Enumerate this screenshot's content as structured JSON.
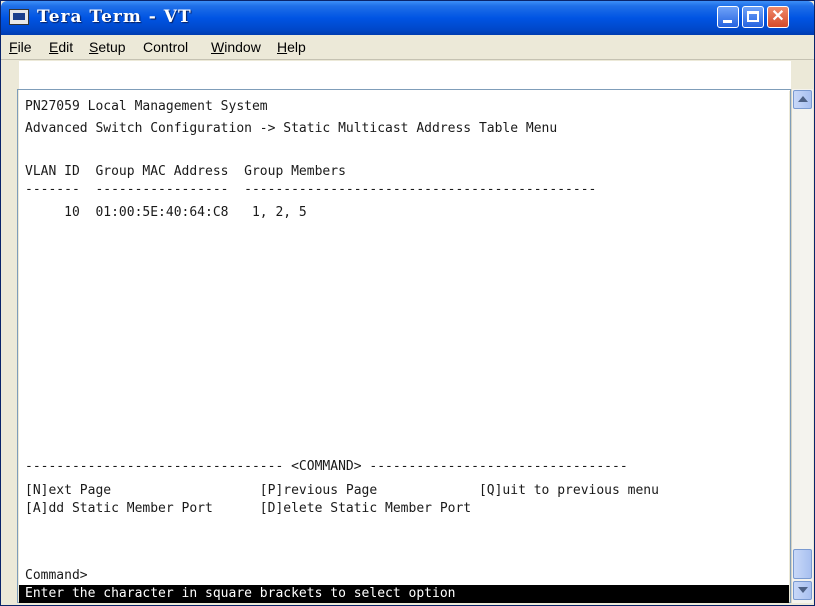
{
  "window": {
    "title": "Tera Term - VT"
  },
  "titlebar_buttons": {
    "close_glyph": "✕"
  },
  "menu": {
    "items": [
      {
        "first": "F",
        "rest": "ile"
      },
      {
        "first": "E",
        "rest": "dit"
      },
      {
        "first": "S",
        "rest": "etup"
      },
      {
        "first": "C",
        "rest": "ontrol",
        "prefix": ""
      },
      {
        "first": "W",
        "rest": "indow"
      },
      {
        "first": "H",
        "rest": "elp"
      }
    ]
  },
  "terminal": {
    "system_name": "PN27059 Local Management System",
    "breadcrumb": "Advanced Switch Configuration -> Static Multicast Address Table Menu",
    "table_header": "VLAN ID  Group MAC Address  Group Members",
    "table_rule": "-------  -----------------  ---------------------------------------------",
    "rows": [
      {
        "text": "     10  01:00:5E:40:64:C8   1, 2, 5"
      }
    ],
    "command_rule": "--------------------------------- <COMMAND> ---------------------------------",
    "commands_line1": "[N]ext Page                   [P]revious Page             [Q]uit to previous menu",
    "commands_line2": "[A]dd Static Member Port      [D]elete Static Member Port",
    "prompt": "Command>",
    "status": "Enter the character in square brackets to select option"
  }
}
